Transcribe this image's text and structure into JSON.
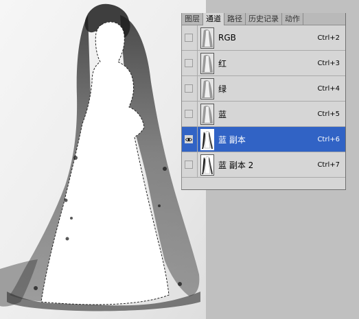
{
  "panel": {
    "tabs": [
      {
        "label": "图层",
        "active": false
      },
      {
        "label": "通道",
        "active": true
      },
      {
        "label": "路径",
        "active": false
      },
      {
        "label": "历史记录",
        "active": false
      },
      {
        "label": "动作",
        "active": false
      }
    ],
    "channels": [
      {
        "name": "RGB",
        "shortcut": "Ctrl+2",
        "visible": false,
        "selected": false
      },
      {
        "name": "红",
        "shortcut": "Ctrl+3",
        "visible": false,
        "selected": false
      },
      {
        "name": "绿",
        "shortcut": "Ctrl+4",
        "visible": false,
        "selected": false
      },
      {
        "name": "蓝",
        "shortcut": "Ctrl+5",
        "visible": false,
        "selected": false
      },
      {
        "name": "蓝 副本",
        "shortcut": "Ctrl+6",
        "visible": true,
        "selected": true
      },
      {
        "name": "蓝 副本 2",
        "shortcut": "Ctrl+7",
        "visible": false,
        "selected": false
      }
    ]
  },
  "colors": {
    "selection_highlight": "#3163c5",
    "workspace_gray": "#c0c0c0",
    "panel_bg": "#d6d6d6"
  },
  "icons": {
    "visibility": "eye-icon"
  }
}
